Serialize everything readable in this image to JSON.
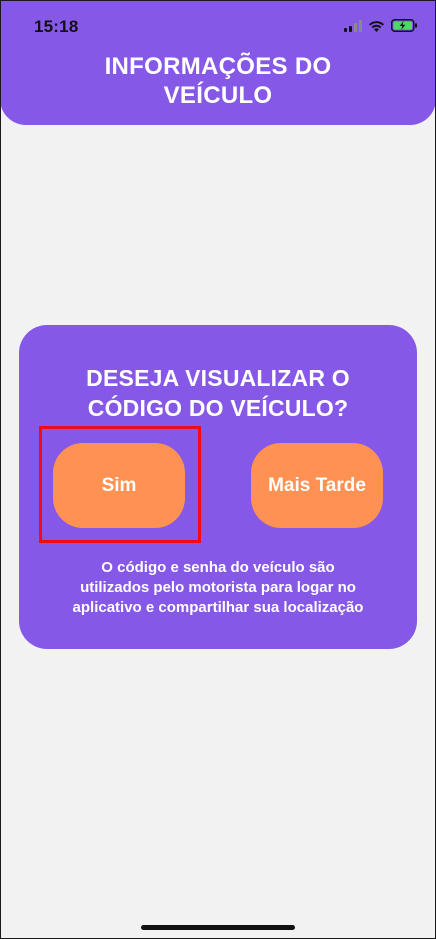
{
  "status_bar": {
    "time": "15:18",
    "icons": [
      "cellular-signal-icon",
      "wifi-icon",
      "battery-charging-icon"
    ]
  },
  "header": {
    "title": "INFORMAÇÕES DO\nVEÍCULO"
  },
  "dialog": {
    "title": "DESEJA VISUALIZAR O\nCÓDIGO DO VEÍCULO?",
    "yes_label": "Sim",
    "later_label": "Mais Tarde",
    "note": "O código e senha do veículo são\nutilizados pelo motorista para logar no\naplicativo e compartilhar sua localização"
  },
  "colors": {
    "primary": "#8658e8",
    "button": "#ff9152",
    "background": "#f2f2f2",
    "highlight": "#f20a18",
    "battery_charge": "#4cd964"
  }
}
